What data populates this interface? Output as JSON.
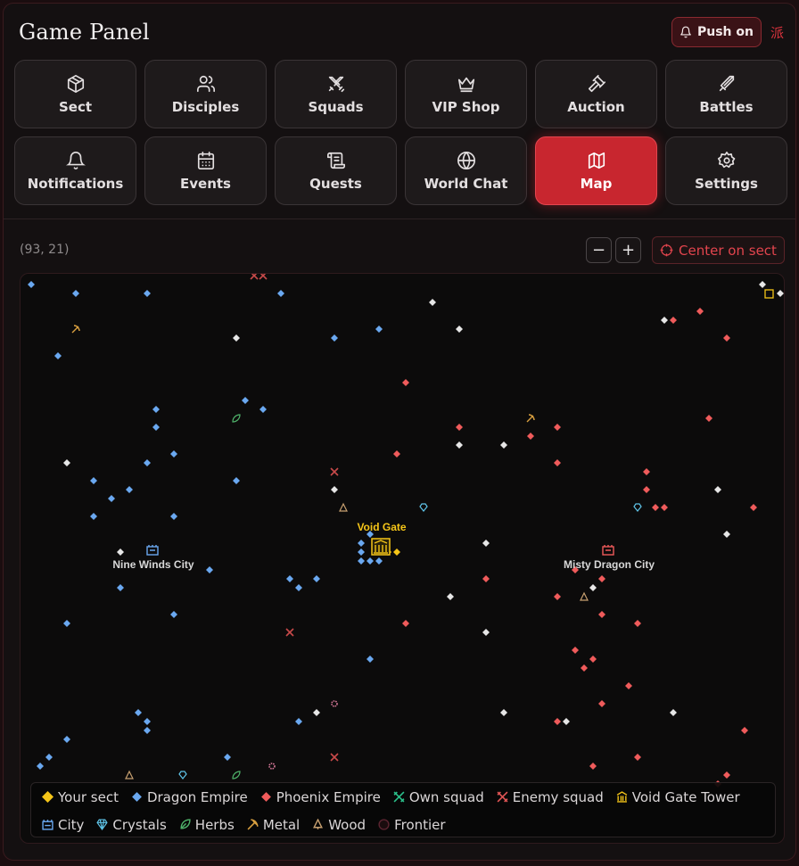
{
  "header": {
    "title": "Game Panel",
    "push_label": "Push on",
    "sect_char": "派"
  },
  "nav": [
    {
      "label": "Sect",
      "icon": "package-icon",
      "active": false
    },
    {
      "label": "Disciples",
      "icon": "users-icon",
      "active": false
    },
    {
      "label": "Squads",
      "icon": "crossed-swords-icon",
      "active": false
    },
    {
      "label": "VIP Shop",
      "icon": "crown-icon",
      "active": false
    },
    {
      "label": "Auction",
      "icon": "gavel-icon",
      "active": false
    },
    {
      "label": "Battles",
      "icon": "sword-icon",
      "active": false
    },
    {
      "label": "Notifications",
      "icon": "bell-icon",
      "active": false
    },
    {
      "label": "Events",
      "icon": "calendar-icon",
      "active": false
    },
    {
      "label": "Quests",
      "icon": "scroll-icon",
      "active": false
    },
    {
      "label": "World Chat",
      "icon": "globe-icon",
      "active": false
    },
    {
      "label": "Map",
      "icon": "map-icon",
      "active": true
    },
    {
      "label": "Settings",
      "icon": "gear-icon",
      "active": false
    }
  ],
  "map": {
    "coords": "(93, 21)",
    "zoom_out": "−",
    "zoom_in": "+",
    "center_label": "Center on sect",
    "places": {
      "void_gate": "Void Gate",
      "nine_winds": "Nine Winds City",
      "misty_dragon": "Misty Dragon City"
    },
    "colors": {
      "your_sect": "#f5c518",
      "dragon_empire": "#6aa8f0",
      "phoenix_empire": "#ef5b5b",
      "neutral": "#e6e6e6",
      "own_squad": "#2bbf8a",
      "enemy_squad": "#c94a4a",
      "crystals": "#5fc4e8",
      "herbs": "#4fb36a",
      "metal": "#d9a040",
      "wood": "#c7a070"
    }
  },
  "legend": [
    {
      "label": "Your sect",
      "icon": "diamond-yellow-icon"
    },
    {
      "label": "Dragon Empire",
      "icon": "diamond-blue-icon"
    },
    {
      "label": "Phoenix Empire",
      "icon": "diamond-red-icon"
    },
    {
      "label": "Own squad",
      "icon": "own-squad-icon"
    },
    {
      "label": "Enemy squad",
      "icon": "enemy-squad-icon"
    },
    {
      "label": "Void Gate Tower",
      "icon": "tower-icon"
    },
    {
      "label": "City",
      "icon": "city-icon"
    },
    {
      "label": "Crystals",
      "icon": "crystal-icon"
    },
    {
      "label": "Herbs",
      "icon": "leaf-icon"
    },
    {
      "label": "Metal",
      "icon": "pickaxe-icon"
    },
    {
      "label": "Wood",
      "icon": "wood-icon"
    },
    {
      "label": "Frontier",
      "icon": "frontier-icon"
    }
  ]
}
